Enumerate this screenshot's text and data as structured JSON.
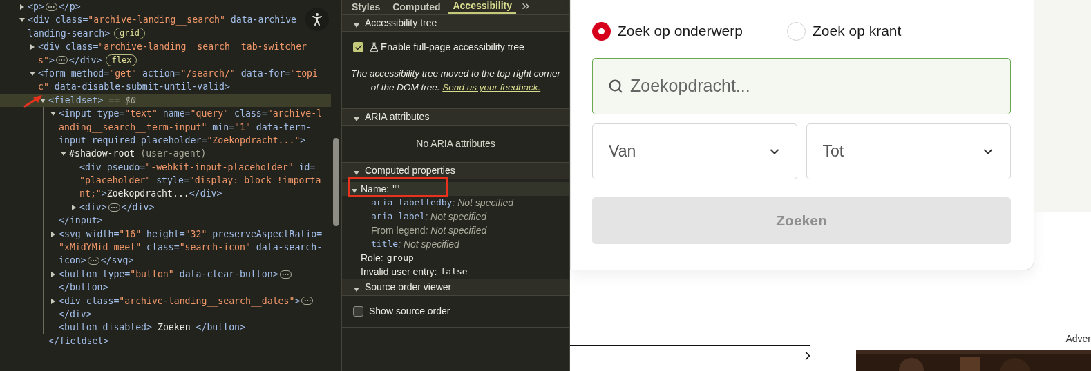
{
  "elements_panel": {
    "nodes": [
      {
        "selected": false,
        "expanded": false,
        "lines": [
          [
            {
              "kind": "tag",
              "text": "<p>"
            },
            {
              "kind": "more"
            },
            {
              "kind": "tag",
              "text": "</p>"
            }
          ]
        ]
      },
      {
        "selected": false,
        "expanded": true,
        "lines": [
          [
            {
              "kind": "tag",
              "text": "<div"
            },
            {
              "kind": "attr",
              "text": " class="
            },
            {
              "kind": "value",
              "text": "\"archive-landing__search\""
            },
            {
              "kind": "attr",
              "text": " data-archive"
            }
          ],
          [
            {
              "kind": "attr",
              "text": "landing-search"
            },
            {
              "kind": "tag",
              "text": ">"
            },
            {
              "kind": "badge",
              "text": "grid"
            }
          ]
        ],
        "children": [
          {
            "selected": false,
            "expanded": false,
            "lines": [
              [
                {
                  "kind": "tag",
                  "text": "<div"
                },
                {
                  "kind": "attr",
                  "text": " class="
                },
                {
                  "kind": "value",
                  "text": "\"archive-landing__search__tab-switcher"
                }
              ],
              [
                {
                  "kind": "value",
                  "text": "s\""
                },
                {
                  "kind": "tag",
                  "text": ">"
                },
                {
                  "kind": "more"
                },
                {
                  "kind": "tag",
                  "text": "</div>"
                },
                {
                  "kind": "badge",
                  "text": "flex"
                }
              ]
            ]
          },
          {
            "selected": false,
            "expanded": true,
            "lines": [
              [
                {
                  "kind": "tag",
                  "text": "<form"
                },
                {
                  "kind": "attr",
                  "text": " method="
                },
                {
                  "kind": "value",
                  "text": "\"get\""
                },
                {
                  "kind": "attr",
                  "text": " action="
                },
                {
                  "kind": "value",
                  "text": "\"/search/\""
                },
                {
                  "kind": "attr",
                  "text": " data-for="
                },
                {
                  "kind": "value",
                  "text": "\"topi"
                }
              ],
              [
                {
                  "kind": "value",
                  "text": "c\""
                },
                {
                  "kind": "attr",
                  "text": " data-disable-submit-until-valid"
                },
                {
                  "kind": "tag",
                  "text": ">"
                }
              ]
            ],
            "children": [
              {
                "selected": true,
                "annotated": true,
                "expanded": true,
                "lines": [
                  [
                    {
                      "kind": "tag",
                      "text": "<fieldset>"
                    },
                    {
                      "kind": "muted",
                      "text": " == "
                    },
                    {
                      "kind": "ref",
                      "text": "$0"
                    }
                  ]
                ],
                "closing": [
                  [
                    {
                      "kind": "tag",
                      "text": "</fieldset>"
                    }
                  ]
                ],
                "children": [
                  {
                    "selected": false,
                    "expanded": true,
                    "lines": [
                      [
                        {
                          "kind": "tag",
                          "text": "<input"
                        },
                        {
                          "kind": "attr",
                          "text": " type="
                        },
                        {
                          "kind": "value",
                          "text": "\"text\""
                        },
                        {
                          "kind": "attr",
                          "text": " name="
                        },
                        {
                          "kind": "value",
                          "text": "\"query\""
                        },
                        {
                          "kind": "attr",
                          "text": " class="
                        },
                        {
                          "kind": "value",
                          "text": "\"archive-l"
                        }
                      ],
                      [
                        {
                          "kind": "value",
                          "text": "anding__search__term-input\""
                        },
                        {
                          "kind": "attr",
                          "text": " min="
                        },
                        {
                          "kind": "value",
                          "text": "\"1\""
                        },
                        {
                          "kind": "attr",
                          "text": " data-term-"
                        }
                      ],
                      [
                        {
                          "kind": "attr",
                          "text": "input required placeholder="
                        },
                        {
                          "kind": "value",
                          "text": "\"Zoekopdracht...\""
                        },
                        {
                          "kind": "tag",
                          "text": ">"
                        }
                      ]
                    ],
                    "closing": [
                      [
                        {
                          "kind": "tag",
                          "text": "</input>"
                        }
                      ]
                    ],
                    "children": [
                      {
                        "selected": false,
                        "expanded": true,
                        "lines": [
                          [
                            {
                              "kind": "text",
                              "text": "#shadow-root"
                            },
                            {
                              "kind": "muted",
                              "text": " (user-agent)"
                            }
                          ]
                        ],
                        "children": [
                          {
                            "selected": false,
                            "lines": [
                              [
                                {
                                  "kind": "tag",
                                  "text": "<div"
                                },
                                {
                                  "kind": "attr",
                                  "text": " pseudo="
                                },
                                {
                                  "kind": "value",
                                  "text": "\"-webkit-input-placeholder\""
                                },
                                {
                                  "kind": "attr",
                                  "text": " id="
                                }
                              ],
                              [
                                {
                                  "kind": "value",
                                  "text": "\"placeholder\""
                                },
                                {
                                  "kind": "attr",
                                  "text": " style="
                                },
                                {
                                  "kind": "value",
                                  "text": "\"display: block !importa"
                                }
                              ],
                              [
                                {
                                  "kind": "value",
                                  "text": "nt;\""
                                },
                                {
                                  "kind": "tag",
                                  "text": ">"
                                },
                                {
                                  "kind": "text",
                                  "text": "Zoekopdracht..."
                                },
                                {
                                  "kind": "tag",
                                  "text": "</div>"
                                }
                              ]
                            ]
                          },
                          {
                            "selected": false,
                            "expanded": false,
                            "lines": [
                              [
                                {
                                  "kind": "tag",
                                  "text": "<div>"
                                },
                                {
                                  "kind": "more"
                                },
                                {
                                  "kind": "tag",
                                  "text": "</div>"
                                }
                              ]
                            ]
                          }
                        ]
                      }
                    ]
                  },
                  {
                    "selected": false,
                    "expanded": false,
                    "lines": [
                      [
                        {
                          "kind": "tag",
                          "text": "<svg"
                        },
                        {
                          "kind": "attr",
                          "text": " width="
                        },
                        {
                          "kind": "value",
                          "text": "\"16\""
                        },
                        {
                          "kind": "attr",
                          "text": " height="
                        },
                        {
                          "kind": "value",
                          "text": "\"32\""
                        },
                        {
                          "kind": "attr",
                          "text": " preserveAspectRatio="
                        }
                      ],
                      [
                        {
                          "kind": "value",
                          "text": "\"xMidYMid meet\""
                        },
                        {
                          "kind": "attr",
                          "text": " class="
                        },
                        {
                          "kind": "value",
                          "text": "\"search-icon\""
                        },
                        {
                          "kind": "attr",
                          "text": " data-search-"
                        }
                      ],
                      [
                        {
                          "kind": "attr",
                          "text": "icon"
                        },
                        {
                          "kind": "tag",
                          "text": ">"
                        },
                        {
                          "kind": "more"
                        },
                        {
                          "kind": "tag",
                          "text": "</svg>"
                        }
                      ]
                    ]
                  },
                  {
                    "selected": false,
                    "expanded": false,
                    "lines": [
                      [
                        {
                          "kind": "tag",
                          "text": "<button"
                        },
                        {
                          "kind": "attr",
                          "text": " type="
                        },
                        {
                          "kind": "value",
                          "text": "\"button\""
                        },
                        {
                          "kind": "attr",
                          "text": " data-clear-button"
                        },
                        {
                          "kind": "tag",
                          "text": ">"
                        },
                        {
                          "kind": "more"
                        }
                      ],
                      [
                        {
                          "kind": "tag",
                          "text": "</button>"
                        }
                      ]
                    ]
                  },
                  {
                    "selected": false,
                    "expanded": false,
                    "lines": [
                      [
                        {
                          "kind": "tag",
                          "text": "<div"
                        },
                        {
                          "kind": "attr",
                          "text": " class="
                        },
                        {
                          "kind": "value",
                          "text": "\"archive-landing__search__dates\""
                        },
                        {
                          "kind": "tag",
                          "text": ">"
                        },
                        {
                          "kind": "more"
                        }
                      ],
                      [
                        {
                          "kind": "tag",
                          "text": "</div>"
                        }
                      ]
                    ]
                  },
                  {
                    "selected": false,
                    "lines": [
                      [
                        {
                          "kind": "tag",
                          "text": "<button"
                        },
                        {
                          "kind": "attr",
                          "text": " disabled"
                        },
                        {
                          "kind": "tag",
                          "text": ">"
                        },
                        {
                          "kind": "text",
                          "text": " Zoeken "
                        },
                        {
                          "kind": "tag",
                          "text": "</button>"
                        }
                      ]
                    ]
                  }
                ]
              }
            ]
          }
        ]
      }
    ]
  },
  "sidebar": {
    "tabs": [
      {
        "label": "Styles",
        "selected": false
      },
      {
        "label": "Computed",
        "selected": false
      },
      {
        "label": "Accessibility",
        "selected": true
      }
    ],
    "sections": [
      {
        "title": "Accessibility tree",
        "expanded": true,
        "items": [
          {
            "kind": "checkbox",
            "label": "Enable full-page accessibility tree",
            "checked": true,
            "experimental": true
          },
          {
            "kind": "note",
            "text": "The accessibility tree moved to the top-right corner of the DOM tree.",
            "link": "Send us your feedback."
          }
        ]
      },
      {
        "title": "ARIA attributes",
        "expanded": true,
        "items": [
          {
            "kind": "empty",
            "text": "No ARIA attributes"
          }
        ]
      },
      {
        "title": "Computed properties",
        "expanded": true,
        "items": [
          {
            "kind": "property",
            "label": "Name:",
            "value": "\"\"",
            "code": false,
            "expanded": true,
            "annotated": true,
            "children": [
              {
                "source": "aria-labelledby",
                "code": true,
                "value": ": Not specified"
              },
              {
                "source": "aria-label",
                "code": true,
                "value": ": Not specified"
              },
              {
                "source": "From legend",
                "code": false,
                "value": ": Not specified"
              },
              {
                "source": "title",
                "code": true,
                "value": ": Not specified"
              }
            ]
          },
          {
            "kind": "property",
            "label": "Role:",
            "value": "group",
            "code": true
          },
          {
            "kind": "property",
            "label": "Invalid user entry:",
            "value": "false",
            "code": true
          }
        ]
      },
      {
        "title": "Source order viewer",
        "expanded": true,
        "items": [
          {
            "kind": "checkbox",
            "label": "Show source order",
            "checked": false,
            "experimental": false
          }
        ]
      }
    ]
  },
  "page": {
    "search_modes": [
      {
        "label": "Zoek op onderwerp",
        "selected": true
      },
      {
        "label": "Zoek op krant",
        "selected": false
      }
    ],
    "query": {
      "placeholder": "Zoekopdracht..."
    },
    "dates": [
      {
        "placeholder": "Van"
      },
      {
        "placeholder": "Tot"
      }
    ],
    "submit": {
      "label": "Zoeken",
      "disabled": true
    },
    "ad_label": "Adver"
  }
}
